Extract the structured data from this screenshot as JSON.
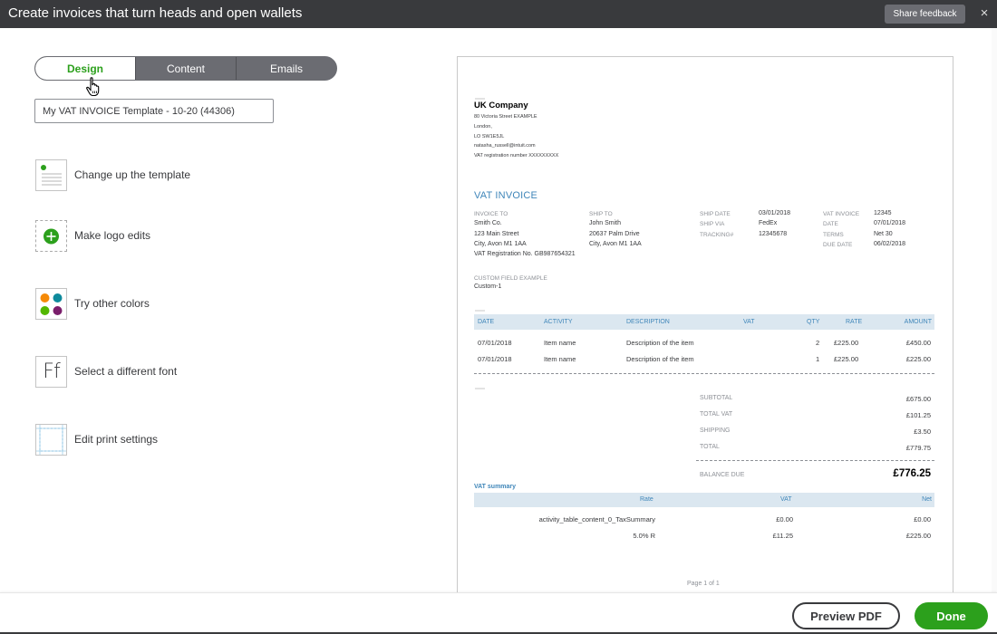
{
  "window": {
    "title": "Create invoices that turn heads and open wallets",
    "share_feedback": "Share feedback",
    "close": "×"
  },
  "tabs": [
    {
      "label": "Design",
      "active": true
    },
    {
      "label": "Content",
      "active": false
    },
    {
      "label": "Emails",
      "active": false
    }
  ],
  "template_name": "My VAT INVOICE Template - 10-20 (44306)",
  "options": [
    {
      "label": "Change up the template",
      "icon": "template-icon"
    },
    {
      "label": "Make logo edits",
      "icon": "add-logo-icon"
    },
    {
      "label": "Try other colors",
      "icon": "color-palette-icon"
    },
    {
      "label": "Select a different font",
      "icon": "font-icon",
      "glyph": "Ff"
    },
    {
      "label": "Edit print settings",
      "icon": "print-settings-icon"
    }
  ],
  "invoice": {
    "company": {
      "name": "UK Company",
      "lines": [
        "80 Victoria Street EXAMPLE",
        "London,",
        "LO SW1E5JL",
        "natasha_russell@intuit.com",
        "VAT registration number XXXXXXXXX"
      ]
    },
    "title": "VAT INVOICE",
    "invoice_to": {
      "label": "INVOICE TO",
      "lines": [
        "Smith Co.",
        "123 Main Street",
        "City, Avon M1 1AA",
        "VAT Registration No. GB987654321"
      ]
    },
    "ship_to": {
      "label": "SHIP TO",
      "lines": [
        "John Smith",
        "20637 Palm Drive",
        "City, Avon M1 1AA"
      ]
    },
    "ship_info": [
      {
        "label": "SHIP DATE",
        "value": "03/01/2018"
      },
      {
        "label": "SHIP VIA",
        "value": "FedEx"
      },
      {
        "label": "TRACKING#",
        "value": "12345678"
      }
    ],
    "invoice_info": [
      {
        "label": "VAT INVOICE",
        "value": "12345"
      },
      {
        "label": "DATE",
        "value": "07/01/2018"
      },
      {
        "label": "TERMS",
        "value": "Net 30"
      },
      {
        "label": "DUE DATE",
        "value": "06/02/2018"
      }
    ],
    "custom_field": {
      "label": "CUSTOM FIELD EXAMPLE",
      "value": "Custom-1"
    },
    "columns": [
      "DATE",
      "ACTIVITY",
      "DESCRIPTION",
      "VAT",
      "QTY",
      "RATE",
      "AMOUNT"
    ],
    "rows": [
      {
        "date": "07/01/2018",
        "activity": "Item name",
        "description": "Description of the item",
        "vat": "",
        "qty": "2",
        "rate": "£225.00",
        "amount": "£450.00"
      },
      {
        "date": "07/01/2018",
        "activity": "Item name",
        "description": "Description of the item",
        "vat": "",
        "qty": "1",
        "rate": "£225.00",
        "amount": "£225.00"
      }
    ],
    "totals": [
      {
        "label": "SUBTOTAL",
        "value": "£675.00"
      },
      {
        "label": "TOTAL VAT",
        "value": "£101.25"
      },
      {
        "label": "SHIPPING",
        "value": "£3.50"
      },
      {
        "label": "TOTAL",
        "value": "£779.75"
      }
    ],
    "balance_due": {
      "label": "BALANCE DUE",
      "value": "£776.25"
    },
    "vat_summary": {
      "title": "VAT summary",
      "columns": [
        "Rate",
        "VAT",
        "Net"
      ],
      "rows": [
        {
          "rate": "activity_table_content_0_TaxSummary",
          "vat": "£0.00",
          "net": "£0.00"
        },
        {
          "rate": "5.0% R",
          "vat": "£11.25",
          "net": "£225.00"
        }
      ]
    },
    "page": "Page 1 of 1"
  },
  "footer": {
    "preview_pdf": "Preview PDF",
    "done": "Done"
  },
  "colors": {
    "accent_green": "#2ca01c",
    "title_bar": "#393a3d",
    "invoice_blue": "#3f86b9",
    "table_header_bg": "#dbe7f0"
  }
}
